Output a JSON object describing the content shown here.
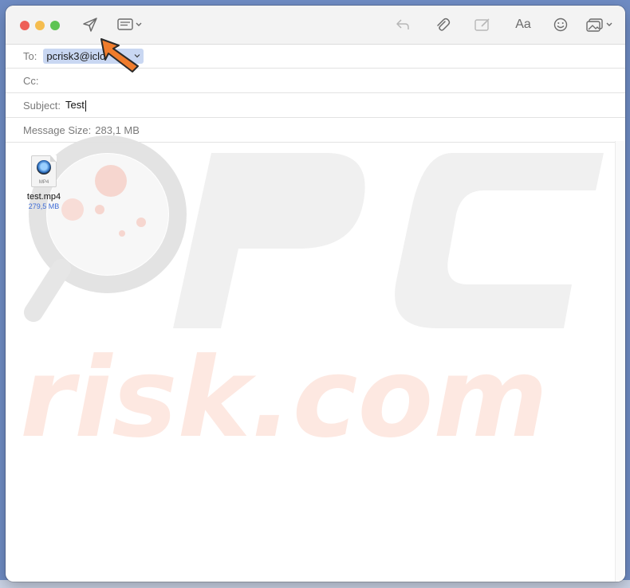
{
  "compose": {
    "to_label": "To:",
    "to_value": "pcrisk3@iclo",
    "cc_label": "Cc:",
    "cc_value": "",
    "subject_label": "Subject:",
    "subject_value": "Test",
    "message_size_label": "Message Size:",
    "message_size_value": "283,1 MB"
  },
  "attachment": {
    "file_name": "test.mp4",
    "file_size": "279,5 MB",
    "file_ext": "MP4"
  },
  "toolbar": {
    "icons": [
      "send-icon",
      "header-fields-icon",
      "reply-icon",
      "attach-icon",
      "markup-icon",
      "format-fonts-icon",
      "emoji-icon",
      "photo-browser-icon"
    ],
    "format_label": "Aa"
  },
  "watermark": {
    "line1": "PC",
    "line2": "risk.com"
  },
  "colors": {
    "desktop": "#6f8cc4",
    "chip": "#c9d7f2",
    "callout_arrow": "#f07c2c",
    "size_text": "#3d6bd6"
  }
}
